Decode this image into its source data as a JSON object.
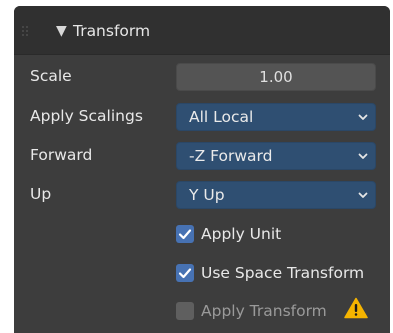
{
  "panel": {
    "title": "Transform",
    "expanded": true
  },
  "rows": {
    "scale": {
      "label": "Scale",
      "value": "1.00"
    },
    "apply_scalings": {
      "label": "Apply Scalings",
      "value": "All Local"
    },
    "forward": {
      "label": "Forward",
      "value": "-Z Forward"
    },
    "up": {
      "label": "Up",
      "value": "Y Up"
    }
  },
  "checkboxes": {
    "apply_unit": {
      "label": "Apply Unit",
      "checked": true
    },
    "use_space_transform": {
      "label": "Use Space Transform",
      "checked": true
    },
    "apply_transform": {
      "label": "Apply Transform",
      "checked": false,
      "warning_icon": "warning-icon"
    }
  },
  "colors": {
    "panel_bg": "#3d3d3d",
    "header_bg": "#303030",
    "dropdown_bg": "#2f4f72",
    "checkbox_on": "#4772b3",
    "warning": "#f5b400"
  }
}
